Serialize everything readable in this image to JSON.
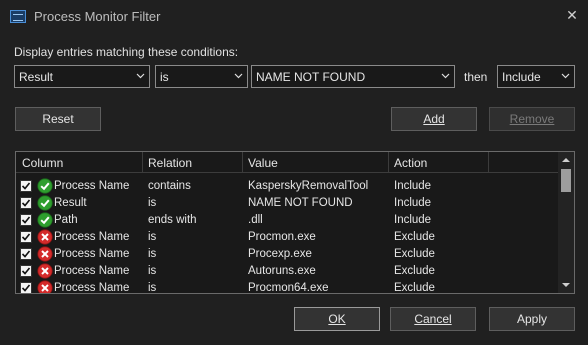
{
  "window": {
    "title": "Process Monitor Filter",
    "close_glyph": "✕"
  },
  "conditions_label": "Display entries matching these conditions:",
  "filter": {
    "column": "Result",
    "relation": "is",
    "value": "NAME NOT FOUND",
    "then_label": "then",
    "action": "Include"
  },
  "buttons": {
    "reset": "Reset",
    "add": "Add",
    "remove": "Remove",
    "ok": "OK",
    "cancel": "Cancel",
    "apply": "Apply"
  },
  "table": {
    "columns": [
      "Column",
      "Relation",
      "Value",
      "Action"
    ],
    "rows": [
      {
        "column": "Process Name",
        "relation": "contains",
        "value": "KasperskyRemovalTool",
        "action": "Include",
        "type": "include",
        "checked": true
      },
      {
        "column": "Result",
        "relation": "is",
        "value": "NAME NOT FOUND",
        "action": "Include",
        "type": "include",
        "checked": true
      },
      {
        "column": "Path",
        "relation": "ends with",
        "value": ".dll",
        "action": "Include",
        "type": "include",
        "checked": true
      },
      {
        "column": "Process Name",
        "relation": "is",
        "value": "Procmon.exe",
        "action": "Exclude",
        "type": "exclude",
        "checked": true
      },
      {
        "column": "Process Name",
        "relation": "is",
        "value": "Procexp.exe",
        "action": "Exclude",
        "type": "exclude",
        "checked": true
      },
      {
        "column": "Process Name",
        "relation": "is",
        "value": "Autoruns.exe",
        "action": "Exclude",
        "type": "exclude",
        "checked": true
      },
      {
        "column": "Process Name",
        "relation": "is",
        "value": "Procmon64.exe",
        "action": "Exclude",
        "type": "exclude",
        "checked": true
      }
    ]
  },
  "icons": {
    "include": "green-check-circle-icon",
    "exclude": "red-x-circle-icon"
  },
  "colors": {
    "background": "#202020",
    "include_green": "#2e9e2e",
    "exclude_red": "#d42a2a"
  }
}
